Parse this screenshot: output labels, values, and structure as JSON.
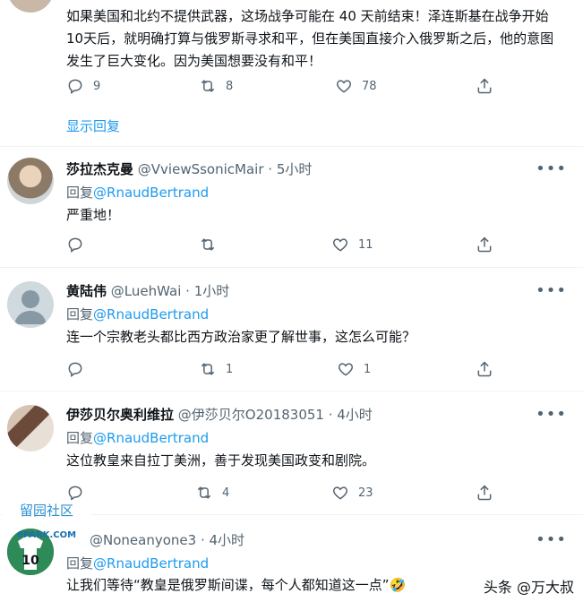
{
  "top_tweet": {
    "text": "如果美国和北约不提供武器，这场战争可能在 40 天前结束！泽连斯基在战争开始10天后，就明确打算与俄罗斯寻求和平，但在美国直接介入俄罗斯之后，他的意图发生了巨大变化。因为美国想要没有和平！",
    "replies": "9",
    "retweets": "8",
    "likes": "78",
    "show_replies": "显示回复"
  },
  "tweets": [
    {
      "name": "莎拉杰克曼",
      "handle": "@VviewSsonicMair",
      "time": "5小时",
      "reply_prefix": "回复",
      "reply_to": "@RnaudBertrand",
      "text": "严重地！",
      "replies": "",
      "retweets": "",
      "likes": "11"
    },
    {
      "name": "黄陆伟",
      "handle": "@LuehWai",
      "time": "1小时",
      "reply_prefix": "回复",
      "reply_to": "@RnaudBertrand",
      "text": "连一个宗教老头都比西方政治家更了解世事，这怎么可能？",
      "replies": "",
      "retweets": "1",
      "likes": "1"
    },
    {
      "name": "伊莎贝尔奥利维拉",
      "handle": "@伊莎贝尔O20183051",
      "time": "4小时",
      "reply_prefix": "回复",
      "reply_to": "@RnaudBertrand",
      "text": "这位教皇来自拉丁美洲，善于发现美国政变和剧院。",
      "replies": "",
      "retweets": "4",
      "likes": "23"
    },
    {
      "name": "",
      "handle": "@Noneanyone3",
      "time": "4小时",
      "reply_prefix": "回复",
      "reply_to": "@RnaudBertrand",
      "text": "让我们等待“教皇是俄罗斯间谍，每个人都知道这一点”🤣",
      "replies": "",
      "retweets": "",
      "likes": ""
    }
  ],
  "separator": " · ",
  "more_glyph": "•••",
  "watermark": "头条 @万大叔",
  "badge": {
    "site": "6PARK.COM",
    "cn": "留园社区",
    "jersey": "10"
  },
  "colors": {
    "link": "#1d9bf0",
    "muted": "#536471",
    "text": "#0f1419"
  }
}
